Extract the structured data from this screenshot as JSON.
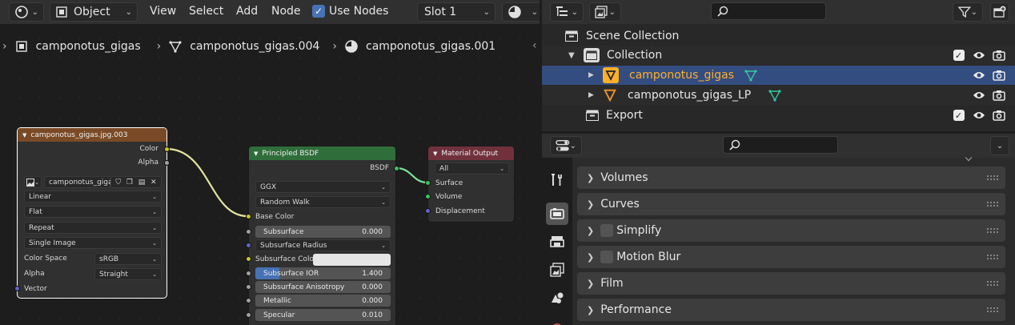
{
  "node_editor": {
    "header": {
      "mode": "Object",
      "menus": [
        "View",
        "Select",
        "Add",
        "Node"
      ],
      "use_nodes_label": "Use Nodes",
      "slot": "Slot 1"
    },
    "breadcrumb": [
      "camponotus_gigas",
      "camponotus_gigas.004",
      "camponotus_gigas.001"
    ],
    "image_node": {
      "title": "camponotus_gigas.jpg.003",
      "outputs": [
        "Color",
        "Alpha"
      ],
      "image_name": "camponotus_giga...",
      "interpolation": "Linear",
      "projection": "Flat",
      "extension": "Repeat",
      "source": "Single Image",
      "color_space_label": "Color Space",
      "color_space": "sRGB",
      "alpha_label": "Alpha",
      "alpha": "Straight",
      "vector_label": "Vector",
      "header_color": "#7a4a26"
    },
    "bsdf_node": {
      "title": "Principled BSDF",
      "output": "BSDF",
      "distribution": "GGX",
      "subsurface_method": "Random Walk",
      "base_color_label": "Base Color",
      "subsurface_label": "Subsurface",
      "subsurface_value": "0.000",
      "subsurface_radius_label": "Subsurface Radius",
      "subsurface_color_label": "Subsurface Colo",
      "subsurface_ior_label": "Subsurface IOR",
      "subsurface_ior_value": "1.400",
      "subsurface_ior_fraction": 0.18,
      "subsurface_anisotropy_label": "Subsurface Anisotropy",
      "subsurface_anisotropy_value": "0.000",
      "metallic_label": "Metallic",
      "metallic_value": "0.000",
      "specular_label": "Specular",
      "specular_value": "0.010",
      "header_color": "#2f6e3a"
    },
    "output_node": {
      "title": "Material Output",
      "target": "All",
      "inputs": [
        "Surface",
        "Volume",
        "Displacement"
      ],
      "header_color": "#70313d"
    }
  },
  "outliner": {
    "rows": [
      {
        "label": "Scene Collection"
      },
      {
        "label": "Collection"
      },
      {
        "label": "camponotus_gigas"
      },
      {
        "label": "camponotus_gigas_LP"
      },
      {
        "label": "Export"
      }
    ],
    "selected_color": "#ffaf29"
  },
  "properties": {
    "panels": [
      "Volumes",
      "Curves",
      "Simplify",
      "Motion Blur",
      "Film",
      "Performance"
    ]
  }
}
